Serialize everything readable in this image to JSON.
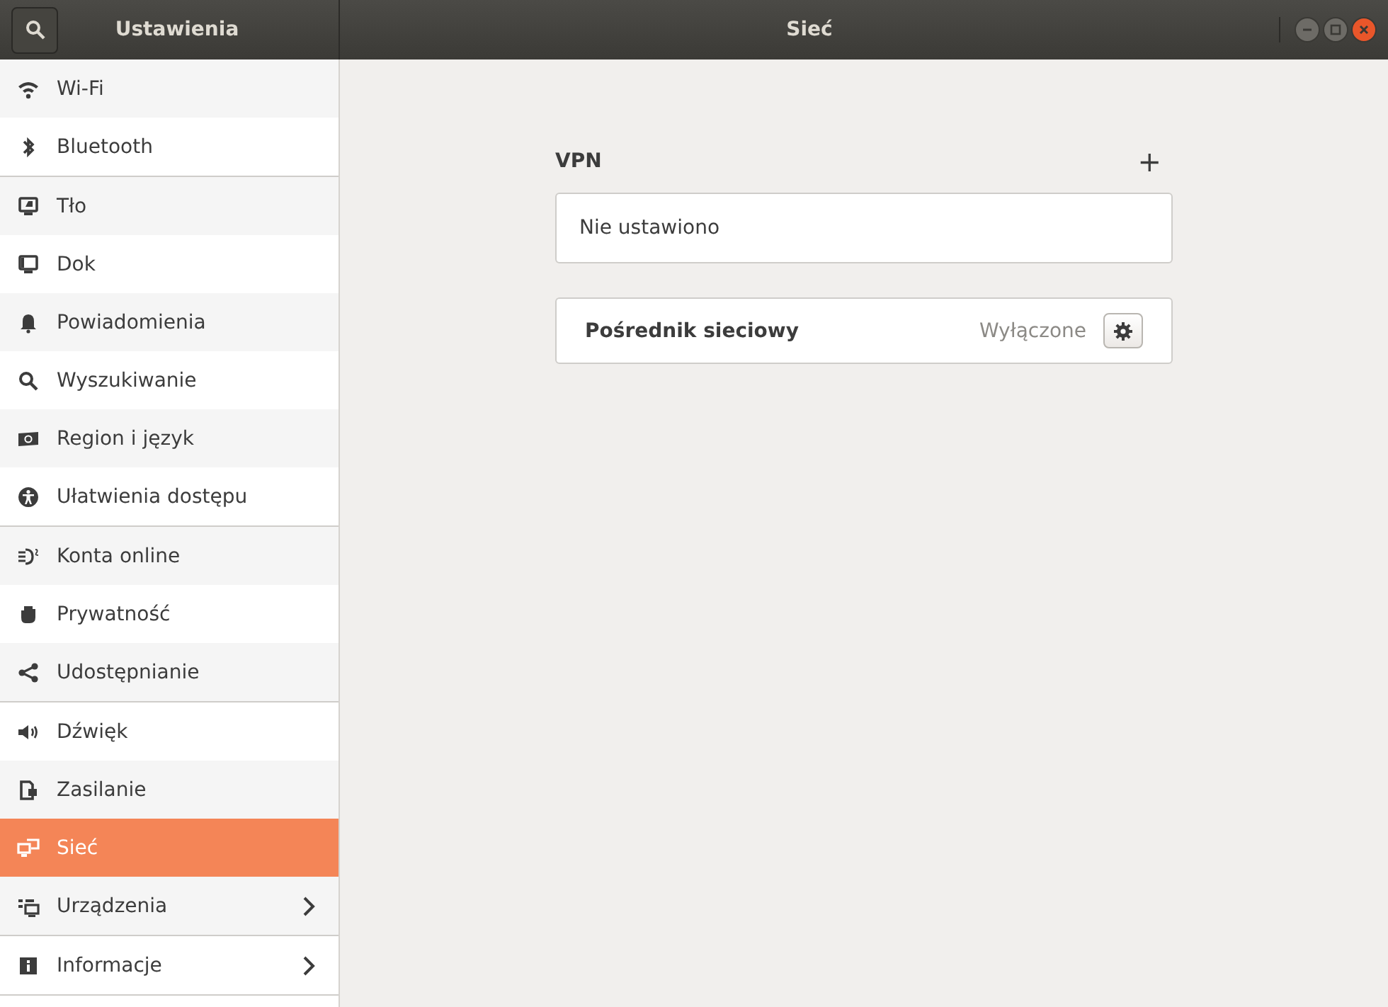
{
  "sidebar": {
    "title": "Ustawienia",
    "groups": [
      {
        "items": [
          {
            "label": "Wi-Fi",
            "selected": false,
            "has_arrow": false
          },
          {
            "label": "Bluetooth",
            "selected": false,
            "has_arrow": false
          }
        ]
      },
      {
        "items": [
          {
            "label": "Tło",
            "selected": false,
            "has_arrow": false
          },
          {
            "label": "Dok",
            "selected": false,
            "has_arrow": false
          },
          {
            "label": "Powiadomienia",
            "selected": false,
            "has_arrow": false
          },
          {
            "label": "Wyszukiwanie",
            "selected": false,
            "has_arrow": false
          },
          {
            "label": "Region i język",
            "selected": false,
            "has_arrow": false
          },
          {
            "label": "Ułatwienia dostępu",
            "selected": false,
            "has_arrow": false
          }
        ]
      },
      {
        "items": [
          {
            "label": "Konta online",
            "selected": false,
            "has_arrow": false
          },
          {
            "label": "Prywatność",
            "selected": false,
            "has_arrow": false
          },
          {
            "label": "Udostępnianie",
            "selected": false,
            "has_arrow": false
          }
        ]
      },
      {
        "items": [
          {
            "label": "Dźwięk",
            "selected": false,
            "has_arrow": false
          },
          {
            "label": "Zasilanie",
            "selected": false,
            "has_arrow": false
          },
          {
            "label": "Sieć",
            "selected": true,
            "has_arrow": false
          },
          {
            "label": "Urządzenia",
            "selected": false,
            "has_arrow": true
          }
        ]
      },
      {
        "items": [
          {
            "label": "Informacje",
            "selected": false,
            "has_arrow": true
          }
        ]
      }
    ]
  },
  "page": {
    "title": "Sieć",
    "vpn": {
      "heading": "VPN",
      "add": "+",
      "empty": "Nie ustawiono"
    },
    "proxy": {
      "label": "Pośrednik sieciowy",
      "status": "Wyłączone"
    }
  }
}
